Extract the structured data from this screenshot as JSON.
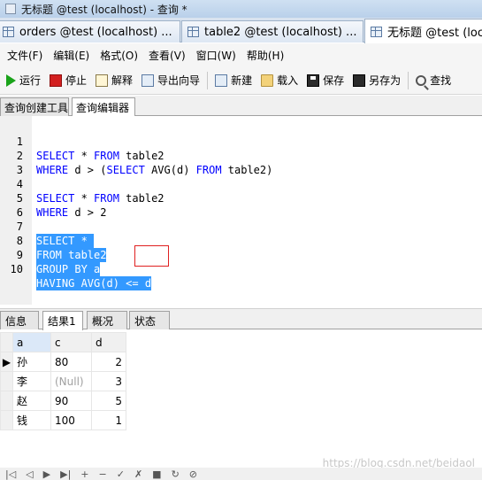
{
  "window": {
    "title": "无标题 @test (localhost) - 查询 *"
  },
  "doc_tabs": [
    {
      "label": "orders @test (localhost) ..."
    },
    {
      "label": "table2 @test (localhost) ..."
    },
    {
      "label": "无标题 @test (loca"
    }
  ],
  "menu": [
    "文件(F)",
    "编辑(E)",
    "格式(O)",
    "查看(V)",
    "窗口(W)",
    "帮助(H)"
  ],
  "toolbar": {
    "run": "运行",
    "stop": "停止",
    "explain": "解释",
    "export": "导出向导",
    "new": "新建",
    "load": "载入",
    "save": "保存",
    "saveas": "另存为",
    "find": "查找"
  },
  "subtabs": [
    "查询创建工具",
    "查询编辑器"
  ],
  "editor": {
    "lines": [
      {
        "n": "1",
        "text": "SELECT * FROM table2"
      },
      {
        "n": "2",
        "text": "WHERE d > (SELECT AVG(d) FROM table2)"
      },
      {
        "n": "3",
        "text": ""
      },
      {
        "n": "4",
        "text": "SELECT * FROM table2"
      },
      {
        "n": "5",
        "text": "WHERE d > 2"
      },
      {
        "n": "6",
        "text": ""
      },
      {
        "n": "7",
        "text": "SELECT *"
      },
      {
        "n": "8",
        "text": "FROM table2"
      },
      {
        "n": "9",
        "text": "GROUP BY a"
      },
      {
        "n": "10",
        "text": "HAVING AVG(d) <= d"
      }
    ]
  },
  "bottom_tabs": [
    "信息",
    "结果1",
    "概况",
    "状态"
  ],
  "results": {
    "columns": [
      "a",
      "c",
      "d"
    ],
    "rows": [
      [
        "孙",
        "80",
        "2"
      ],
      [
        "李",
        "(Null)",
        "3"
      ],
      [
        "赵",
        "90",
        "5"
      ],
      [
        "钱",
        "100",
        "1"
      ]
    ]
  },
  "nav_icons": [
    "first-icon",
    "prev-icon",
    "next-icon",
    "last-icon",
    "add-icon",
    "delete-icon",
    "apply-icon",
    "discard-icon",
    "stop-icon",
    "refresh-icon",
    "stop-load-icon"
  ],
  "watermark": "https://blog.csdn.net/beidaol"
}
